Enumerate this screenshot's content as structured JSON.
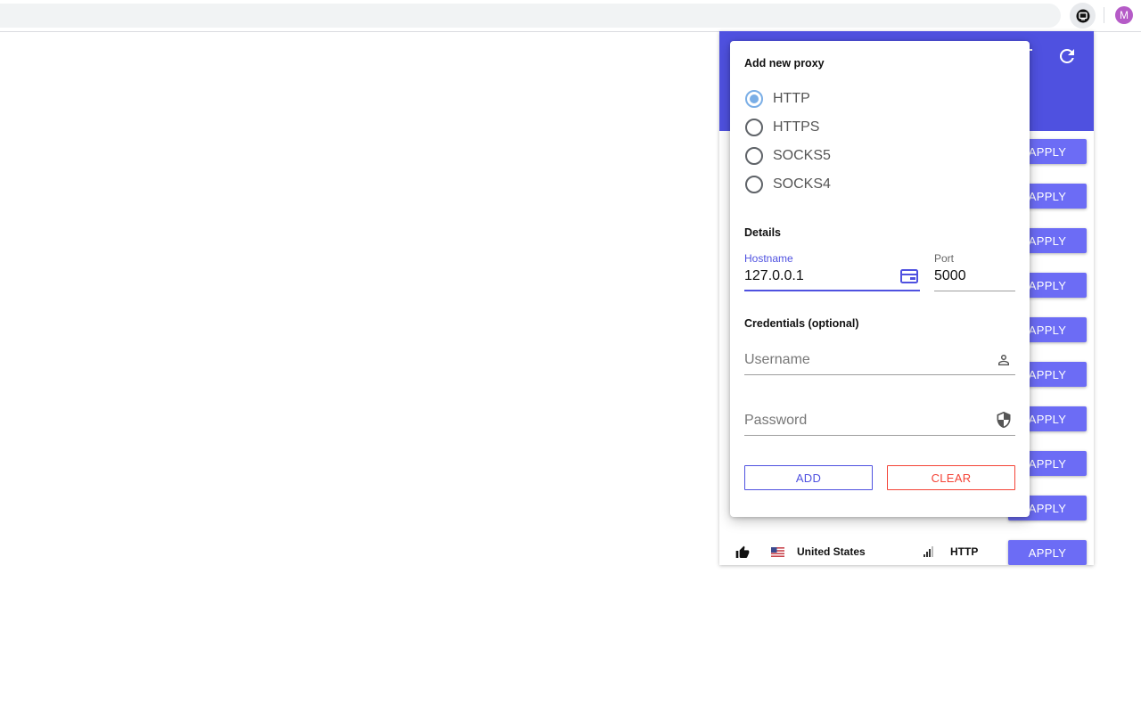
{
  "browser": {
    "profile_initial": "M",
    "extension_icon": "extension-icon"
  },
  "popup": {
    "header_icons": [
      "filter-icon",
      "refresh-icon"
    ],
    "proxy_rows": [
      {
        "apply_label": "APPLY"
      },
      {
        "apply_label": "APPLY"
      },
      {
        "apply_label": "APPLY"
      },
      {
        "apply_label": "APPLY"
      },
      {
        "apply_label": "APPLY"
      },
      {
        "apply_label": "APPLY"
      },
      {
        "apply_label": "APPLY"
      },
      {
        "apply_label": "APPLY"
      },
      {
        "apply_label": "APPLY"
      },
      {
        "country": "United States",
        "type": "HTTP",
        "apply_label": "APPLY"
      }
    ]
  },
  "dialog": {
    "title": "Add new proxy",
    "protocols": [
      {
        "label": "HTTP",
        "checked": true
      },
      {
        "label": "HTTPS",
        "checked": false
      },
      {
        "label": "SOCKS5",
        "checked": false
      },
      {
        "label": "SOCKS4",
        "checked": false
      }
    ],
    "details_title": "Details",
    "hostname_label": "Hostname",
    "hostname_value": "127.0.0.1",
    "port_label": "Port",
    "port_value": "5000",
    "credentials_title": "Credentials (optional)",
    "username_placeholder": "Username",
    "password_placeholder": "Password",
    "add_label": "ADD",
    "clear_label": "CLEAR"
  },
  "colors": {
    "accent": "#4f51e0",
    "apply_button": "#6c6cf5",
    "radio_checked": "#7aaee6",
    "clear": "#f44336",
    "profile_avatar": "#b55bc7"
  }
}
